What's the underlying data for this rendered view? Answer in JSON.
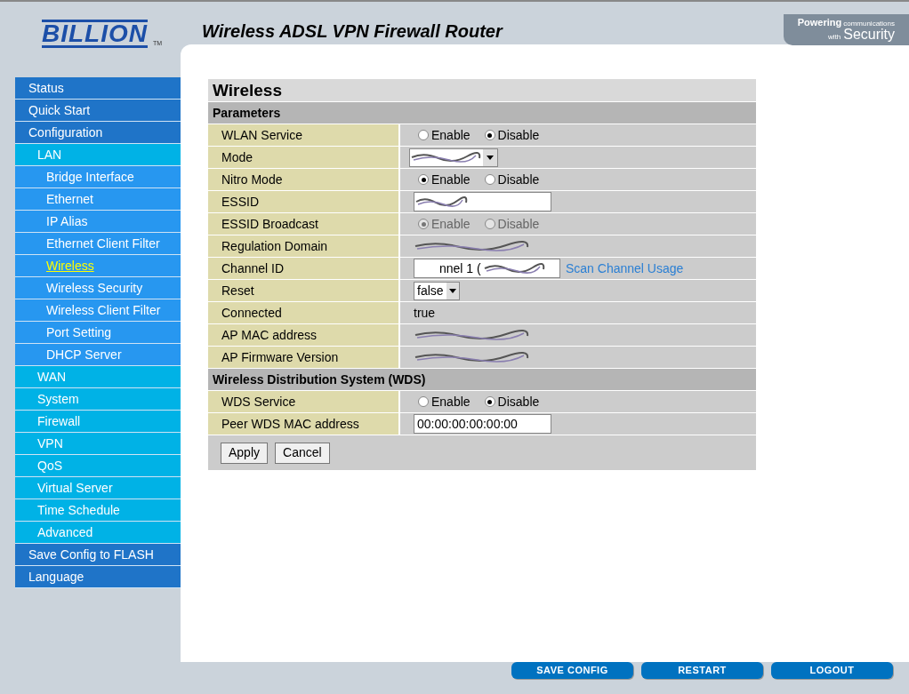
{
  "header": {
    "logo": "BILLION",
    "trademark": "TM",
    "title": "Wireless ADSL VPN Firewall Router",
    "tagline_top": "Powering",
    "tagline_small": "communications",
    "tagline_with": "with",
    "tagline_big": "Security"
  },
  "sidebar": {
    "items": [
      {
        "label": "Status",
        "selected": false
      },
      {
        "label": "Quick Start",
        "selected": false
      },
      {
        "label": "Configuration",
        "selected": false,
        "children": [
          {
            "label": "LAN",
            "selected": false,
            "children": [
              {
                "label": "Bridge Interface",
                "selected": false
              },
              {
                "label": "Ethernet",
                "selected": false
              },
              {
                "label": "IP Alias",
                "selected": false
              },
              {
                "label": "Ethernet Client Filter",
                "selected": false
              },
              {
                "label": "Wireless",
                "selected": true
              },
              {
                "label": "Wireless Security",
                "selected": false
              },
              {
                "label": "Wireless Client Filter",
                "selected": false
              },
              {
                "label": "Port Setting",
                "selected": false
              },
              {
                "label": "DHCP Server",
                "selected": false
              }
            ]
          },
          {
            "label": "WAN",
            "selected": false
          },
          {
            "label": "System",
            "selected": false
          },
          {
            "label": "Firewall",
            "selected": false
          },
          {
            "label": "VPN",
            "selected": false
          },
          {
            "label": "QoS",
            "selected": false
          },
          {
            "label": "Virtual Server",
            "selected": false
          },
          {
            "label": "Time Schedule",
            "selected": false
          },
          {
            "label": "Advanced",
            "selected": false
          }
        ]
      },
      {
        "label": "Save Config to FLASH",
        "selected": false
      },
      {
        "label": "Language",
        "selected": false
      }
    ]
  },
  "form": {
    "title": "Wireless",
    "sections": [
      {
        "title": "Parameters",
        "rows": [
          {
            "kind": "radio",
            "label": "WLAN Service",
            "disabled": false,
            "options": [
              {
                "label": "Enable",
                "selected": false
              },
              {
                "label": "Disable",
                "selected": true
              }
            ]
          },
          {
            "kind": "redacted-select",
            "label": "Mode"
          },
          {
            "kind": "radio",
            "label": "Nitro Mode",
            "disabled": false,
            "options": [
              {
                "label": "Enable",
                "selected": true
              },
              {
                "label": "Disable",
                "selected": false
              }
            ]
          },
          {
            "kind": "redacted-input",
            "label": "ESSID"
          },
          {
            "kind": "radio",
            "label": "ESSID Broadcast",
            "disabled": true,
            "options": [
              {
                "label": "Enable",
                "selected": true
              },
              {
                "label": "Disable",
                "selected": false
              }
            ]
          },
          {
            "kind": "redacted",
            "label": "Regulation Domain"
          },
          {
            "kind": "channel",
            "label": "Channel ID",
            "value": "nnel 1 (",
            "link": "Scan Channel Usage"
          },
          {
            "kind": "select",
            "label": "Reset",
            "value": "false"
          },
          {
            "kind": "text",
            "label": "Connected",
            "value": "true"
          },
          {
            "kind": "redacted",
            "label": "AP MAC address"
          },
          {
            "kind": "redacted",
            "label": "AP Firmware Version"
          }
        ]
      },
      {
        "title": "Wireless Distribution System (WDS)",
        "rows": [
          {
            "kind": "radio",
            "label": "WDS Service",
            "disabled": false,
            "options": [
              {
                "label": "Enable",
                "selected": false
              },
              {
                "label": "Disable",
                "selected": true
              }
            ]
          },
          {
            "kind": "input",
            "label": "Peer WDS MAC address",
            "value": "00:00:00:00:00:00"
          }
        ]
      }
    ],
    "buttons": [
      "Apply",
      "Cancel"
    ]
  },
  "footer_buttons": [
    "SAVE CONFIG",
    "RESTART",
    "LOGOUT"
  ]
}
